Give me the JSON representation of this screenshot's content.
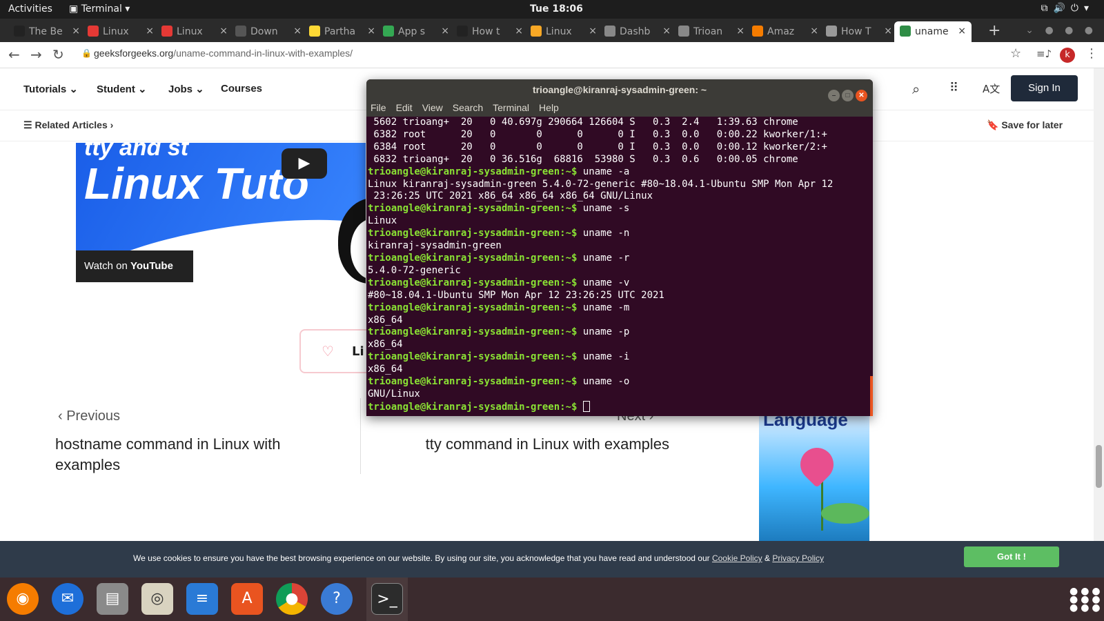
{
  "topbar": {
    "activities": "Activities",
    "app": "Terminal",
    "clock": "Tue 18:06"
  },
  "tabs": [
    {
      "label": "The Be",
      "color": "#222"
    },
    {
      "label": "Linux",
      "color": "#e53935"
    },
    {
      "label": "Linux",
      "color": "#e53935"
    },
    {
      "label": "Down",
      "color": "#555"
    },
    {
      "label": "Partha",
      "color": "#fdd835"
    },
    {
      "label": "App s",
      "color": "#34a853"
    },
    {
      "label": "How t",
      "color": "#222"
    },
    {
      "label": "Linux",
      "color": "#f9a825"
    },
    {
      "label": "Dashb",
      "color": "#888"
    },
    {
      "label": "Trioan",
      "color": "#888"
    },
    {
      "label": "Amaz",
      "color": "#f57c00"
    },
    {
      "label": "How T",
      "color": "#999"
    },
    {
      "label": "uname",
      "color": "#2f8d46"
    }
  ],
  "browser": {
    "url_domain": "geeksforgeeks.org",
    "url_path": "/uname-command-in-linux-with-examples/",
    "avatar": "k"
  },
  "gfg": {
    "nav": [
      "Tutorials",
      "Student",
      "Jobs",
      "Courses"
    ],
    "signin": "Sign In",
    "related": "Related Articles",
    "save": "Save for later",
    "video": {
      "title": "Linux Tuto",
      "top": "tty and st",
      "watch": "Watch on",
      "yt": "YouTube"
    },
    "like": "Li",
    "prev_label": "Previous",
    "next_label": "Next",
    "prev_title": "hostname command in Linux with examples",
    "next_title": "tty command in Linux with examples",
    "ad_title": "Language"
  },
  "terminal": {
    "title": "trioangle@kiranraj-sysadmin-green: ~",
    "menu": [
      "File",
      "Edit",
      "View",
      "Search",
      "Terminal",
      "Help"
    ],
    "prompt": "trioangle@kiranraj-sysadmin-green:~$",
    "lines": [
      {
        "t": "out",
        "v": " 5602 trioang+  20   0 40.697g 290664 126604 S   0.3  2.4   1:39.63 chrome"
      },
      {
        "t": "out",
        "v": " 6382 root      20   0       0      0      0 I   0.3  0.0   0:00.22 kworker/1:+"
      },
      {
        "t": "out",
        "v": " 6384 root      20   0       0      0      0 I   0.3  0.0   0:00.12 kworker/2:+"
      },
      {
        "t": "out",
        "v": " 6832 trioang+  20   0 36.516g  68816  53980 S   0.3  0.6   0:00.05 chrome"
      },
      {
        "t": "cmd",
        "v": " uname -a"
      },
      {
        "t": "out",
        "v": "Linux kiranraj-sysadmin-green 5.4.0-72-generic #80~18.04.1-Ubuntu SMP Mon Apr 12"
      },
      {
        "t": "out",
        "v": " 23:26:25 UTC 2021 x86_64 x86_64 x86_64 GNU/Linux"
      },
      {
        "t": "cmd",
        "v": " uname -s"
      },
      {
        "t": "out",
        "v": "Linux"
      },
      {
        "t": "cmd",
        "v": " uname -n"
      },
      {
        "t": "out",
        "v": "kiranraj-sysadmin-green"
      },
      {
        "t": "cmd",
        "v": " uname -r"
      },
      {
        "t": "out",
        "v": "5.4.0-72-generic"
      },
      {
        "t": "cmd",
        "v": " uname -v"
      },
      {
        "t": "out",
        "v": "#80~18.04.1-Ubuntu SMP Mon Apr 12 23:26:25 UTC 2021"
      },
      {
        "t": "cmd",
        "v": " uname -m"
      },
      {
        "t": "out",
        "v": "x86_64"
      },
      {
        "t": "cmd",
        "v": " uname -p"
      },
      {
        "t": "out",
        "v": "x86_64"
      },
      {
        "t": "cmd",
        "v": " uname -i"
      },
      {
        "t": "out",
        "v": "x86_64"
      },
      {
        "t": "cmd",
        "v": " uname -o"
      },
      {
        "t": "out",
        "v": "GNU/Linux"
      },
      {
        "t": "cmd",
        "v": " "
      }
    ]
  },
  "cookie": {
    "text": "We use cookies to ensure you have the best browsing experience on our website. By using our site, you acknowledge that you have read and understood our ",
    "cookie_link": "Cookie Policy",
    "amp": " & ",
    "privacy_link": "Privacy Policy",
    "button": "Got It !"
  },
  "dock": [
    "firefox-icon",
    "thunderbird-icon",
    "files-icon",
    "rhythmbox-icon",
    "writer-icon",
    "software-icon",
    "chrome-icon",
    "help-icon",
    "terminal-icon"
  ]
}
